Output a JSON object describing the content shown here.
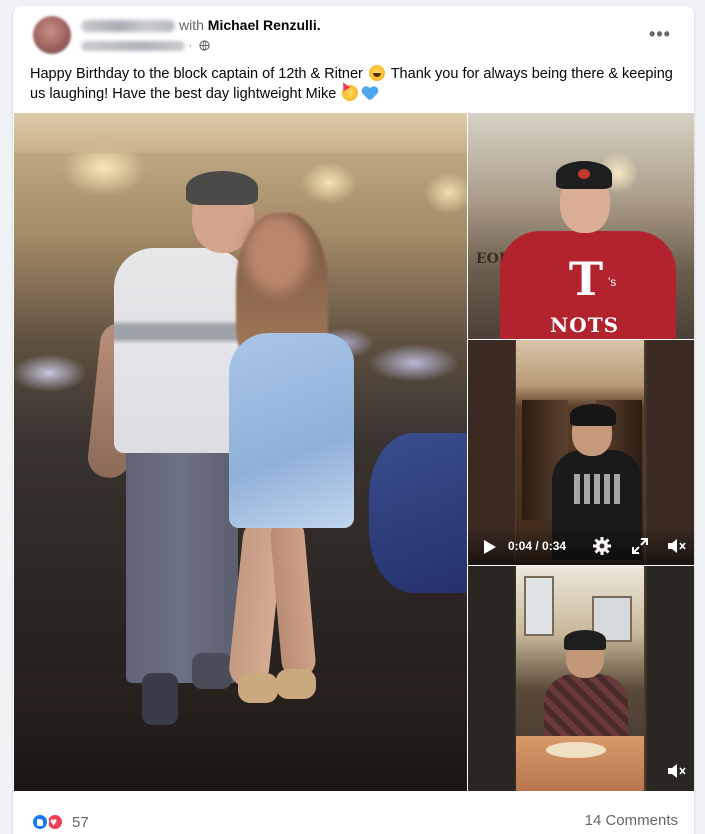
{
  "post": {
    "author_with": "with",
    "tagged_name": "Michael Renzulli.",
    "body": "Happy Birthday to the block captain of 12th & Ritner",
    "body_mid": "Thank you for always being there & keeping us laughing! Have the best day lightweight Mike",
    "more_label": "•••"
  },
  "media": {
    "top_right": {
      "shirt_letter": "T",
      "shirt_suffix": "'s",
      "shirt_word": "NOTS",
      "sign_text": "EOH"
    },
    "video": {
      "time": "0:04 / 0:34"
    }
  },
  "footer": {
    "reaction_count": "57",
    "comments": "14 Comments"
  },
  "colors": {
    "like": "#1877f2",
    "love": "#f33e58",
    "secondary_text": "#65676b"
  }
}
